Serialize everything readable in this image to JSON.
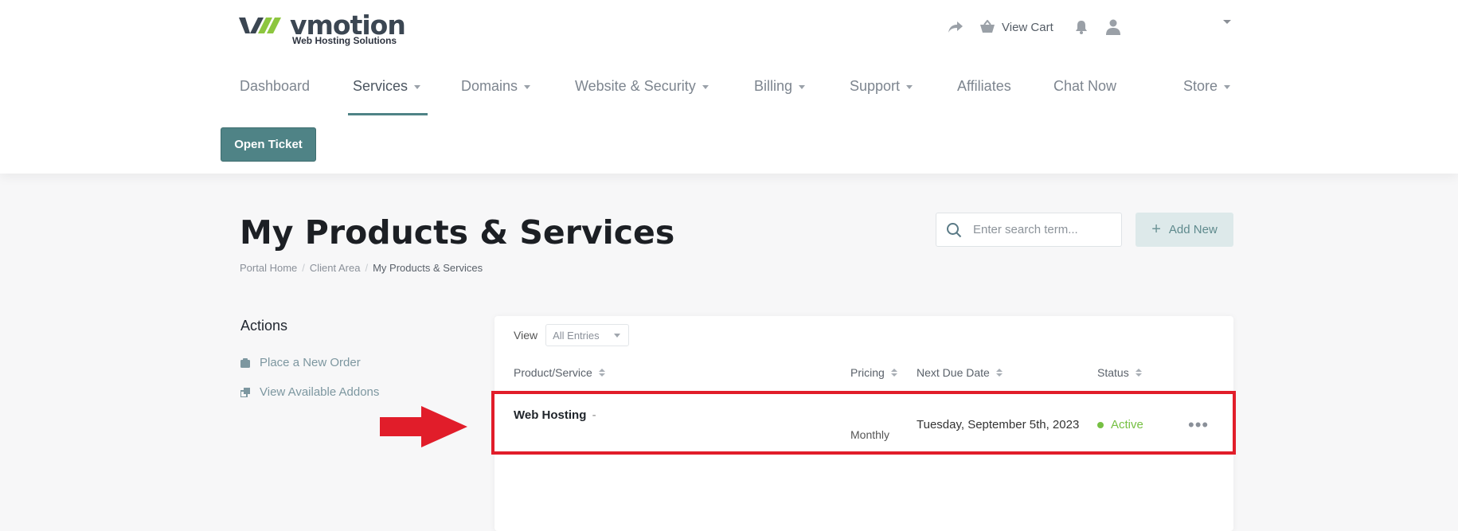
{
  "brand": {
    "name": "vmotion",
    "tagline": "Web Hosting Solutions",
    "colors": {
      "primary": "#4f8386",
      "logo_green": "#8dc63f",
      "logo_dark": "#3b4652",
      "highlight": "#e11d2a",
      "active": "#76c043"
    }
  },
  "topbar": {
    "share_icon": "share-arrow-icon",
    "cart_label": "View Cart",
    "cart_icon": "basket-icon",
    "bell_icon": "bell-icon",
    "user_icon": "user-icon"
  },
  "nav": {
    "items": [
      {
        "label": "Dashboard",
        "dropdown": false
      },
      {
        "label": "Services",
        "dropdown": true,
        "active": true
      },
      {
        "label": "Domains",
        "dropdown": true
      },
      {
        "label": "Website & Security",
        "dropdown": true
      },
      {
        "label": "Billing",
        "dropdown": true
      },
      {
        "label": "Support",
        "dropdown": true
      },
      {
        "label": "Affiliates",
        "dropdown": false
      },
      {
        "label": "Chat Now",
        "dropdown": false
      },
      {
        "label": "Store",
        "dropdown": true
      }
    ],
    "open_ticket_label": "Open Ticket"
  },
  "page": {
    "title": "My Products & Services",
    "breadcrumb": [
      "Portal Home",
      "Client Area",
      "My Products & Services"
    ],
    "search_placeholder": "Enter search term...",
    "add_new_label": "Add New"
  },
  "sidebar": {
    "title": "Actions",
    "items": [
      {
        "label": "Place a New Order",
        "icon": "shopping-bag-icon"
      },
      {
        "label": "View Available Addons",
        "icon": "addons-icon"
      }
    ]
  },
  "table": {
    "view_label": "View",
    "view_selected": "All Entries",
    "headers": [
      "Product/Service",
      "Pricing",
      "Next Due Date",
      "Status"
    ],
    "rows": [
      {
        "product": "Web Hosting",
        "product_suffix": "-",
        "pricing": "Monthly",
        "next_due": "Tuesday, September 5th, 2023",
        "status": "Active"
      }
    ]
  }
}
